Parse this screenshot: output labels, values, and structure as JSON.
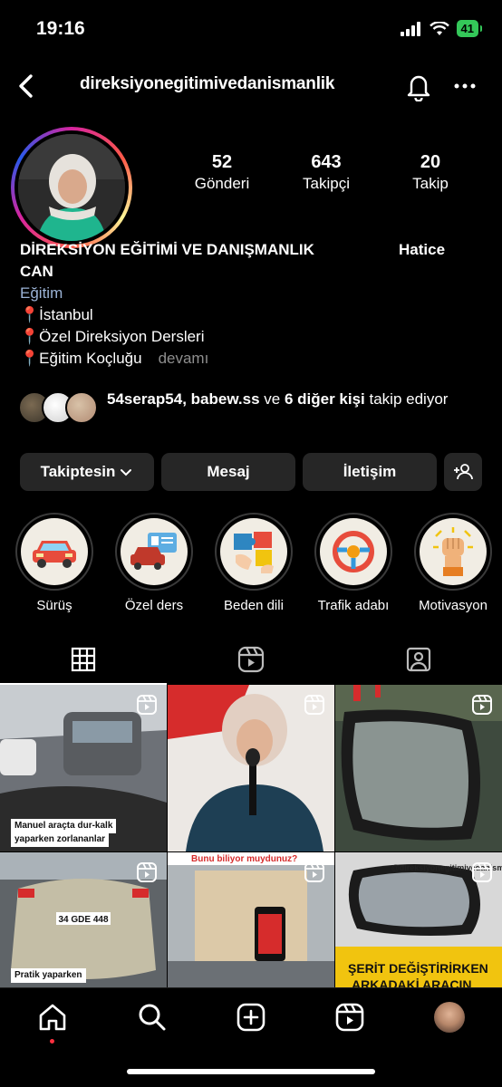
{
  "status_bar": {
    "time": "19:16",
    "battery": "41"
  },
  "header": {
    "username": "direksiyonegitimivedanismanlik"
  },
  "stats": [
    {
      "num": "52",
      "label": "Gönderi"
    },
    {
      "num": "643",
      "label": "Takipçi"
    },
    {
      "num": "20",
      "label": "Takip"
    }
  ],
  "bio": {
    "name_part1": "DİREKSİYON EĞİTİMİ VE DANIŞMANLIK",
    "name_part2": "Hatice",
    "name_part3": "CAN",
    "category": "Eğitim",
    "lines": [
      "📍İstanbul",
      "📍Özel Direksiyon Dersleri",
      "📍Eğitim Koçluğu"
    ],
    "more": "devamı"
  },
  "followed_by": {
    "user1": "54serap54",
    "sep": ", ",
    "user2": "babew.ss",
    "and": " ve ",
    "others": "6 diğer kişi",
    "suffix": " takip ediyor"
  },
  "actions": {
    "follow": "Takiptesin",
    "message": "Mesaj",
    "contact": "İletişim"
  },
  "highlights": [
    {
      "label": "Sürüş",
      "icon": "red-car-icon"
    },
    {
      "label": "Özel ders",
      "icon": "car-license-icon"
    },
    {
      "label": "Beden dili",
      "icon": "puzzle-icon"
    },
    {
      "label": "Trafik adabı",
      "icon": "steering-wheel-icon"
    },
    {
      "label": "Motivasyon",
      "icon": "raised-fist-icon"
    }
  ],
  "tabs": [
    "grid-icon",
    "reels-icon",
    "tagged-icon"
  ],
  "posts": [
    {
      "caption1": "Manuel araçta dur-kalk",
      "caption2": "yaparken zorlananlar"
    },
    {
      "caption1": ""
    },
    {
      "caption1": ""
    },
    {
      "caption1": "Pratik yaparken",
      "plate": "34 GDE 448"
    },
    {
      "caption1": "Bunu biliyor muydunuz?"
    },
    {
      "caption1": "@direksiyonegitimivedanismanlik",
      "caption2": "ŞERİT DEĞİŞTİRİRKEN",
      "caption3": "ARKADAKİ ARACIN"
    }
  ],
  "colors": {
    "accent_red": "#ff3040",
    "button_bg": "#262626",
    "battery_green": "#34c759"
  }
}
